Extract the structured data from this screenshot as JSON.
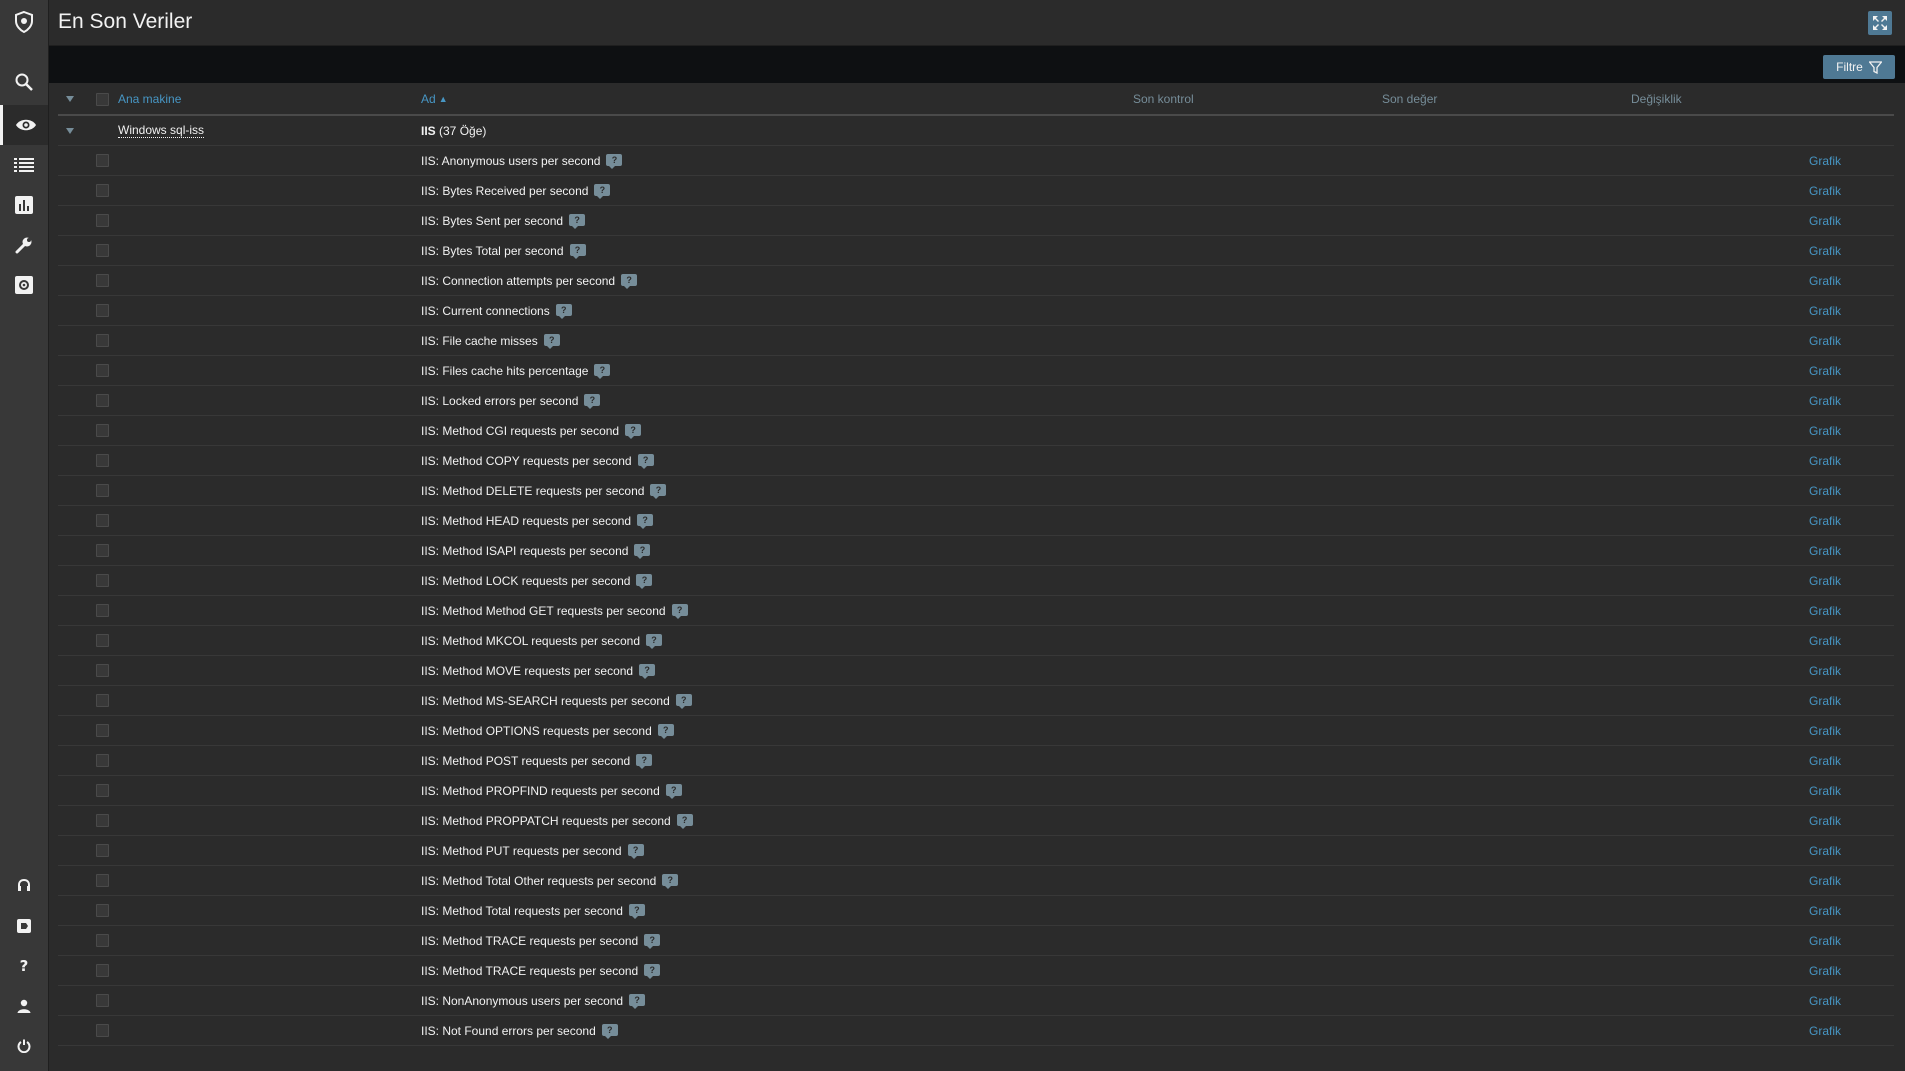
{
  "header": {
    "title": "En Son Veriler"
  },
  "filter": {
    "label": "Filtre"
  },
  "columns": {
    "host": "Ana makine",
    "name": "Ad",
    "last_check": "Son kontrol",
    "last_value": "Son değer",
    "change": "Değişiklik"
  },
  "group": {
    "host": "Windows sql-iss",
    "title": "IIS",
    "count": "(37 Öğe)"
  },
  "graph_label": "Grafik",
  "items": [
    "IIS: Anonymous users per second",
    "IIS: Bytes Received per second",
    "IIS: Bytes Sent per second",
    "IIS: Bytes Total per second",
    "IIS: Connection attempts per second",
    "IIS: Current connections",
    "IIS: File cache misses",
    "IIS: Files cache hits percentage",
    "IIS: Locked errors per second",
    "IIS: Method CGI requests per second",
    "IIS: Method COPY requests per second",
    "IIS: Method DELETE requests per second",
    "IIS: Method HEAD requests per second",
    "IIS: Method ISAPI requests per second",
    "IIS: Method LOCK requests per second",
    "IIS: Method Method GET requests per second",
    "IIS: Method MKCOL requests per second",
    "IIS: Method MOVE requests per second",
    "IIS: Method MS-SEARCH requests per second",
    "IIS: Method OPTIONS requests per second",
    "IIS: Method POST requests per second",
    "IIS: Method PROPFIND requests per second",
    "IIS: Method PROPPATCH requests per second",
    "IIS: Method PUT requests per second",
    "IIS: Method Total Other requests per second",
    "IIS: Method Total requests per second",
    "IIS: Method TRACE requests per second",
    "IIS: Method TRACE requests per second",
    "IIS: NonAnonymous users per second",
    "IIS: Not Found errors per second"
  ],
  "sidebar": {
    "top": [
      "shield-logo-icon",
      "search-icon",
      "eye-icon",
      "list-icon",
      "bar-chart-icon",
      "wrench-icon",
      "gear-icon"
    ],
    "bottom": [
      "headset-icon",
      "share-icon",
      "help-icon",
      "user-icon",
      "power-icon"
    ]
  },
  "colors": {
    "accent": "#4796c4",
    "button": "#4f7994",
    "bg": "#2b2b2b",
    "sidebar": "#383838"
  }
}
